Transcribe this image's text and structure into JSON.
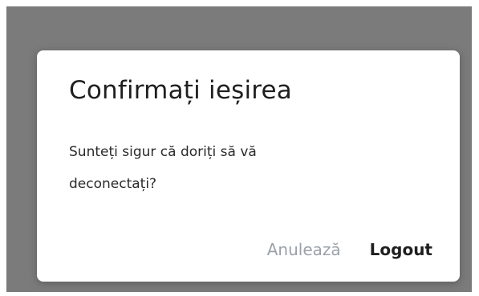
{
  "dialog": {
    "title": "Confirmați ieșirea",
    "message": "Sunteți sigur că doriți să vă deconectați?",
    "cancel_label": "Anulează",
    "confirm_label": "Logout"
  },
  "colors": {
    "scrim": "#7b7b7b",
    "dialog_background": "#ffffff",
    "cancel_text": "#9aa1a8",
    "confirm_text": "#1f1f1f"
  }
}
